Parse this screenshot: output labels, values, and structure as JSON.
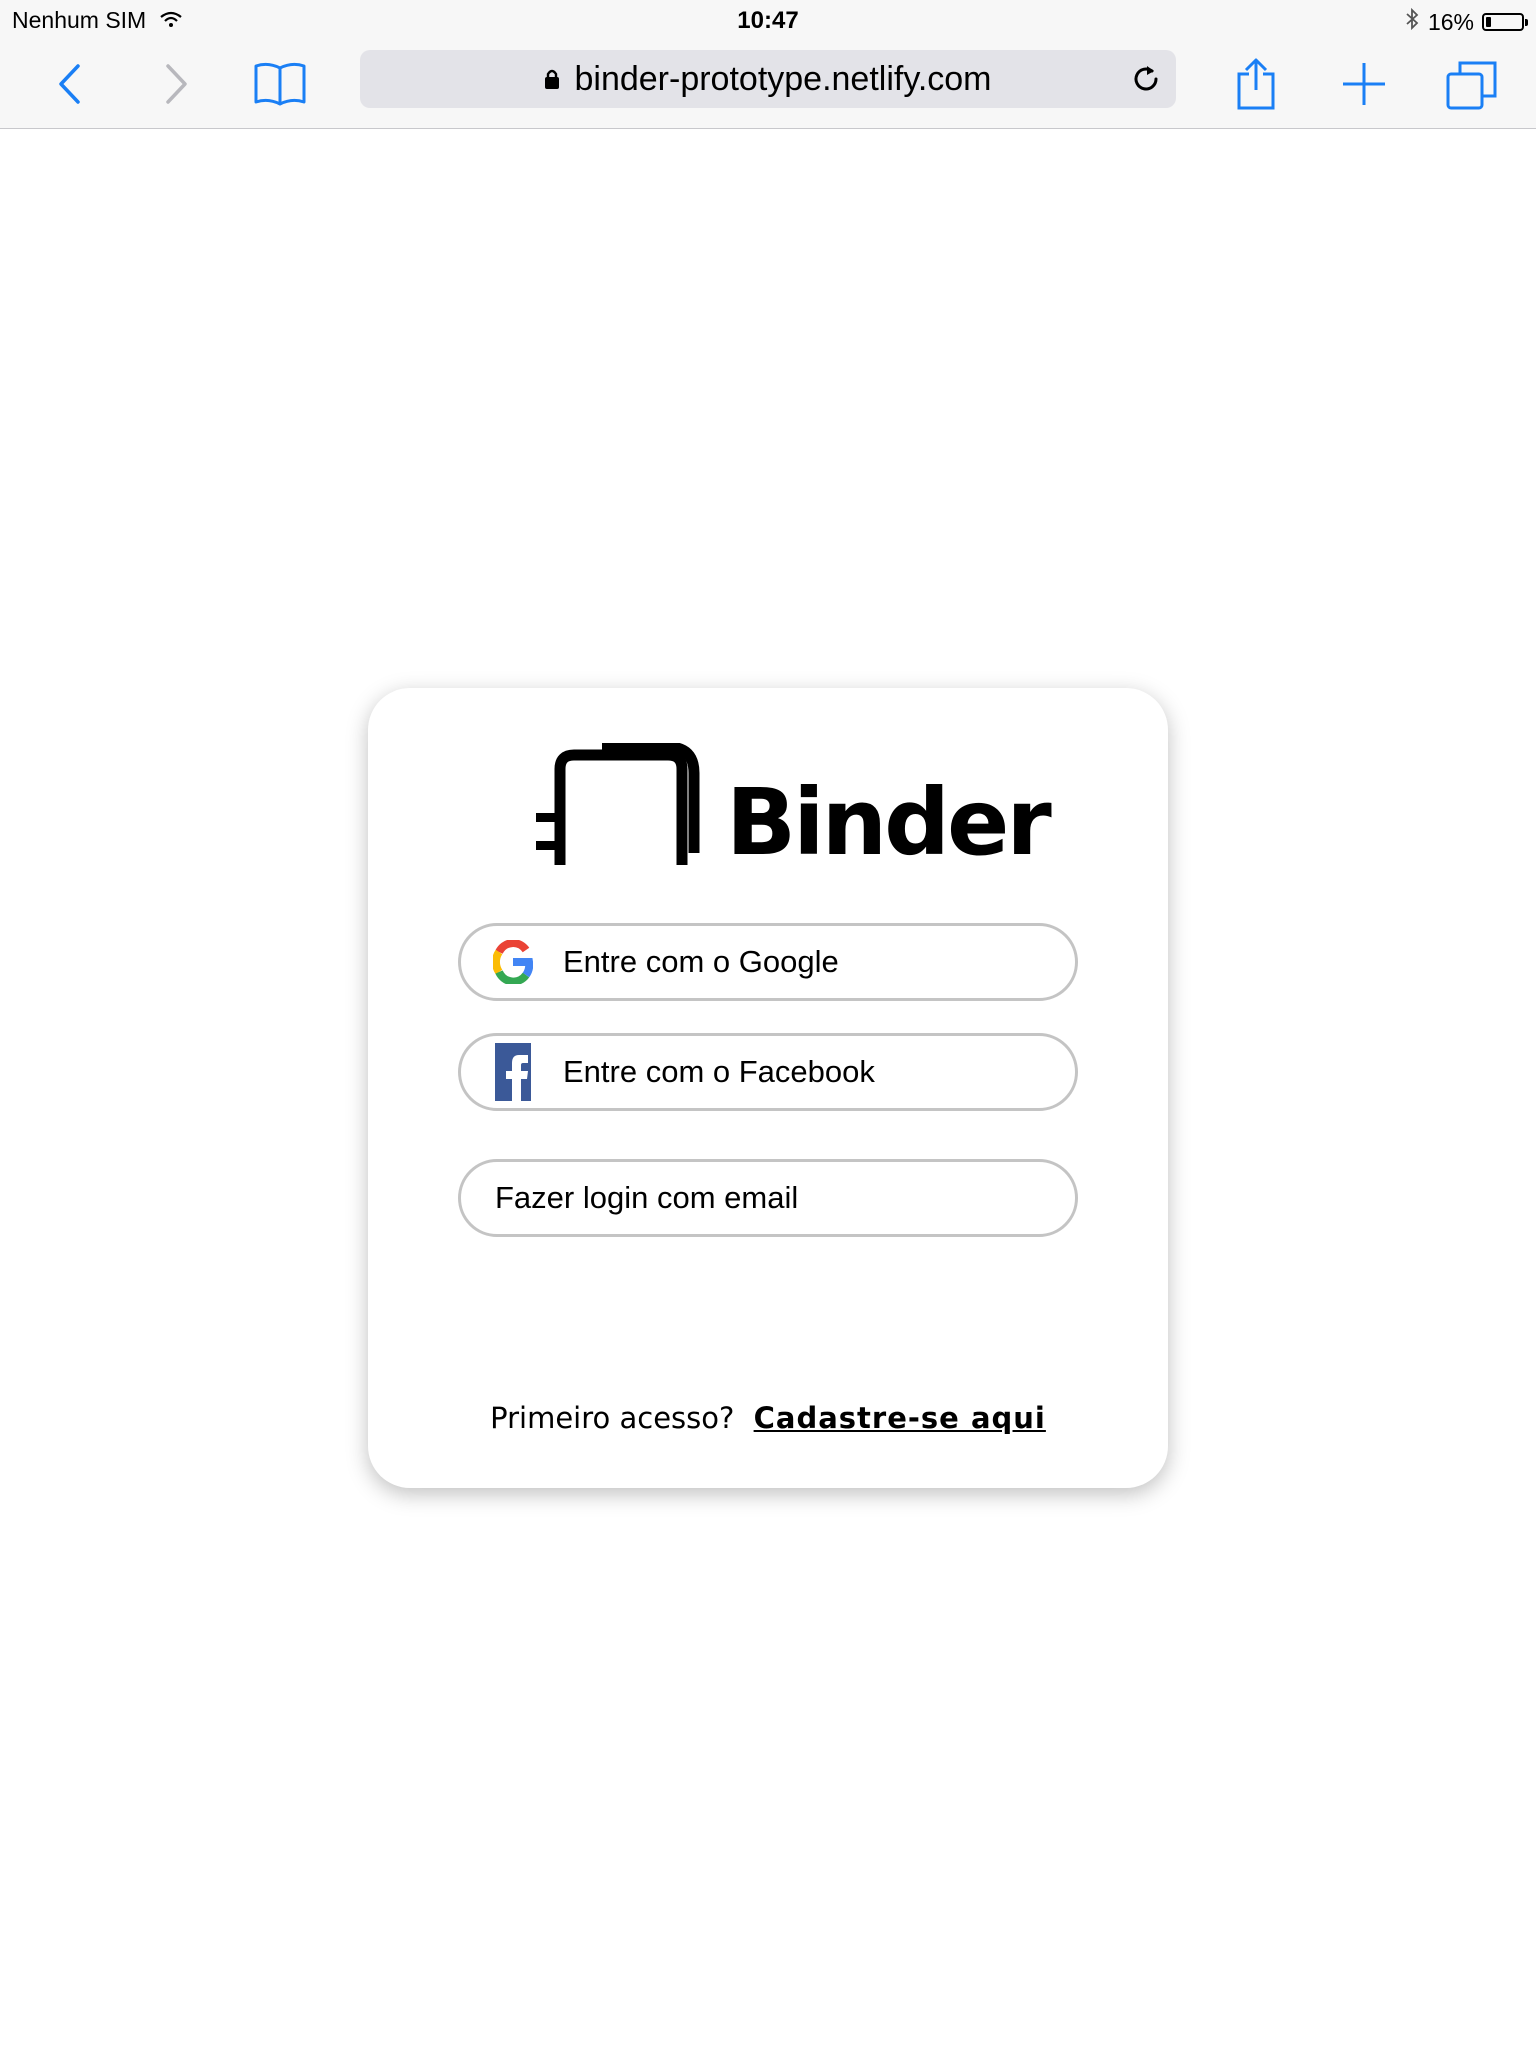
{
  "status_bar": {
    "carrier": "Nenhum SIM",
    "time": "10:47",
    "battery_percent_label": "16%",
    "battery_level": 0.16
  },
  "toolbar": {
    "url": "binder-prototype.netlify.com",
    "accent_color": "#1a7ff5"
  },
  "login_card": {
    "logo_text": "Binder",
    "google_button_label": "Entre com o Google",
    "facebook_button_label": "Entre com o Facebook",
    "email_button_label": "Fazer login com email",
    "first_access_text": "Primeiro acesso?",
    "signup_link_label": "Cadastre-se aqui"
  }
}
